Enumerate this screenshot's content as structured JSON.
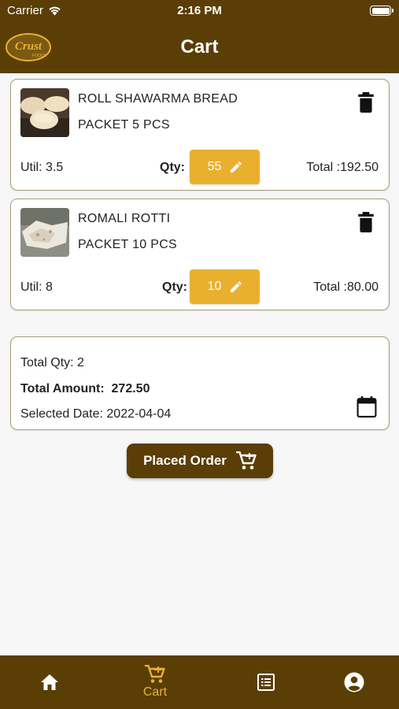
{
  "status_bar": {
    "carrier": "Carrier",
    "time": "2:16 PM"
  },
  "header": {
    "title": "Cart",
    "logo_text": "Crust",
    "logo_subtext": "FOODS"
  },
  "cart_items": [
    {
      "name": "ROLL SHAWARMA BREAD",
      "pack": "PACKET 5 PCS",
      "util": "Util:  3.5",
      "qty_label": "Qty:",
      "qty": "55",
      "total": "Total :192.50",
      "image": "shawarma-bread"
    },
    {
      "name": "ROMALI ROTTI",
      "pack": "PACKET 10 PCS",
      "util": "Util:  8",
      "qty_label": "Qty:",
      "qty": "10",
      "total": "Total :80.00",
      "image": "romali-rotti"
    }
  ],
  "summary": {
    "total_qty": "Total Qty:  2",
    "total_amount_label": "Total Amount:",
    "total_amount_value": "272.50",
    "selected_date": "Selected Date:  2022-04-04"
  },
  "place_order": {
    "label": "Placed Order",
    "icon": "cart-icon"
  },
  "bottom_nav": {
    "items": [
      {
        "icon": "home-icon",
        "label": ""
      },
      {
        "icon": "cart-icon",
        "label": "Cart",
        "active": true
      },
      {
        "icon": "list-icon",
        "label": ""
      },
      {
        "icon": "account-icon",
        "label": ""
      }
    ]
  },
  "colors": {
    "brand": "#5a3e06",
    "accent": "#e9b030",
    "background": "#f7f7f7"
  }
}
